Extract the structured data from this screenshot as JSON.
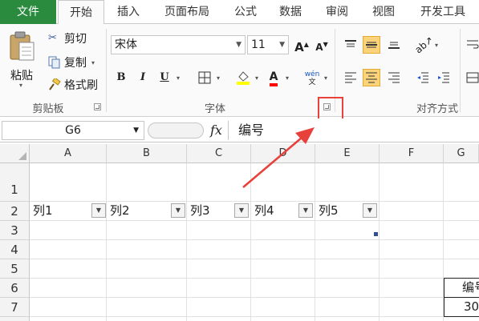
{
  "tabs": [
    "文件",
    "开始",
    "插入",
    "页面布局",
    "公式",
    "数据",
    "审阅",
    "视图",
    "开发工具"
  ],
  "clipboard": {
    "paste": "粘贴",
    "cut": "剪切",
    "copy": "复制",
    "format_painter": "格式刷",
    "label": "剪贴板"
  },
  "font": {
    "name": "宋体",
    "size": "11",
    "grow": "A",
    "shrink": "A",
    "bold": "B",
    "italic": "I",
    "underline": "U",
    "color_fill": "#ffff00",
    "color_font": "#ff0000",
    "label": "字体",
    "phonetic": "wén"
  },
  "alignment": {
    "label": "对齐方式"
  },
  "formula_bar": {
    "cell_ref": "G6",
    "fx": "fx",
    "content": "编号"
  },
  "columns": [
    "A",
    "B",
    "C",
    "D",
    "E",
    "F",
    "G"
  ],
  "rows": [
    "1",
    "2",
    "3",
    "4",
    "5",
    "6",
    "7"
  ],
  "headers_row2": [
    "列1",
    "列2",
    "列3",
    "列4",
    "列5"
  ],
  "g6": "编号",
  "g7": "30",
  "accent": "#e8403a"
}
